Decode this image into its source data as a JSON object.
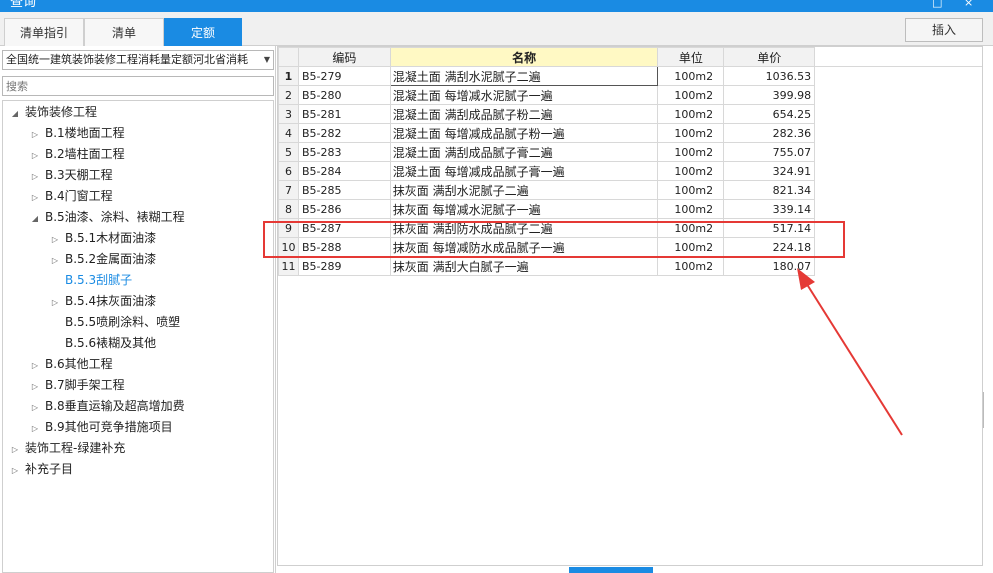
{
  "window": {
    "title": "查询",
    "maximize_icon": "□",
    "close_icon": "×"
  },
  "tabs": [
    {
      "label": "清单指引"
    },
    {
      "label": "清单"
    },
    {
      "label": "定额"
    }
  ],
  "toolbar": {
    "insert_label": "插入"
  },
  "left": {
    "library": "全国统一建筑装饰装修工程消耗量定额河北省消耗",
    "search_placeholder": "搜索",
    "tree": [
      {
        "label": "装饰装修工程",
        "level": 0,
        "toggle": "◢"
      },
      {
        "label": "B.1楼地面工程",
        "level": 1,
        "toggle": "▷"
      },
      {
        "label": "B.2墙柱面工程",
        "level": 1,
        "toggle": "▷"
      },
      {
        "label": "B.3天棚工程",
        "level": 1,
        "toggle": "▷"
      },
      {
        "label": "B.4门窗工程",
        "level": 1,
        "toggle": "▷"
      },
      {
        "label": "B.5油漆、涂料、裱糊工程",
        "level": 1,
        "toggle": "◢"
      },
      {
        "label": "B.5.1木材面油漆",
        "level": 2,
        "toggle": "▷"
      },
      {
        "label": "B.5.2金属面油漆",
        "level": 2,
        "toggle": "▷"
      },
      {
        "label": "B.5.3刮腻子",
        "level": 2,
        "toggle": ""
      },
      {
        "label": "B.5.4抹灰面油漆",
        "level": 2,
        "toggle": "▷"
      },
      {
        "label": "B.5.5喷刷涂料、喷塑",
        "level": 2,
        "toggle": ""
      },
      {
        "label": "B.5.6裱糊及其他",
        "level": 2,
        "toggle": ""
      },
      {
        "label": "B.6其他工程",
        "level": 1,
        "toggle": "▷"
      },
      {
        "label": "B.7脚手架工程",
        "level": 1,
        "toggle": "▷"
      },
      {
        "label": "B.8垂直运输及超高增加费",
        "level": 1,
        "toggle": "▷"
      },
      {
        "label": "B.9其他可竞争措施项目",
        "level": 1,
        "toggle": "▷"
      },
      {
        "label": "装饰工程-绿建补充",
        "level": 0,
        "toggle": "▷"
      },
      {
        "label": "补充子目",
        "level": 0,
        "toggle": "▷"
      }
    ]
  },
  "grid": {
    "headers": {
      "code": "编码",
      "name": "名称",
      "unit": "单位",
      "price": "单价"
    },
    "rows": [
      {
        "no": "1",
        "code": "B5-279",
        "name": "混凝土面 满刮水泥腻子二遍",
        "unit": "100m2",
        "price": "1036.53"
      },
      {
        "no": "2",
        "code": "B5-280",
        "name": "混凝土面 每增减水泥腻子一遍",
        "unit": "100m2",
        "price": "399.98"
      },
      {
        "no": "3",
        "code": "B5-281",
        "name": "混凝土面 满刮成品腻子粉二遍",
        "unit": "100m2",
        "price": "654.25"
      },
      {
        "no": "4",
        "code": "B5-282",
        "name": "混凝土面 每增减成品腻子粉一遍",
        "unit": "100m2",
        "price": "282.36"
      },
      {
        "no": "5",
        "code": "B5-283",
        "name": "混凝土面 满刮成品腻子膏二遍",
        "unit": "100m2",
        "price": "755.07"
      },
      {
        "no": "6",
        "code": "B5-284",
        "name": "混凝土面 每增减成品腻子膏一遍",
        "unit": "100m2",
        "price": "324.91"
      },
      {
        "no": "7",
        "code": "B5-285",
        "name": "抹灰面 满刮水泥腻子二遍",
        "unit": "100m2",
        "price": "821.34"
      },
      {
        "no": "8",
        "code": "B5-286",
        "name": "抹灰面 每增减水泥腻子一遍",
        "unit": "100m2",
        "price": "339.14"
      },
      {
        "no": "9",
        "code": "B5-287",
        "name": "抹灰面 满刮防水成品腻子二遍",
        "unit": "100m2",
        "price": "517.14"
      },
      {
        "no": "10",
        "code": "B5-288",
        "name": "抹灰面 每增减防水成品腻子一遍",
        "unit": "100m2",
        "price": "224.18"
      },
      {
        "no": "11",
        "code": "B5-289",
        "name": "抹灰面 满刮大白腻子一遍",
        "unit": "100m2",
        "price": "180.07"
      }
    ]
  },
  "colors": {
    "accent": "#1a8be3",
    "highlight": "#e53935",
    "header_highlight": "#fff9c4"
  }
}
